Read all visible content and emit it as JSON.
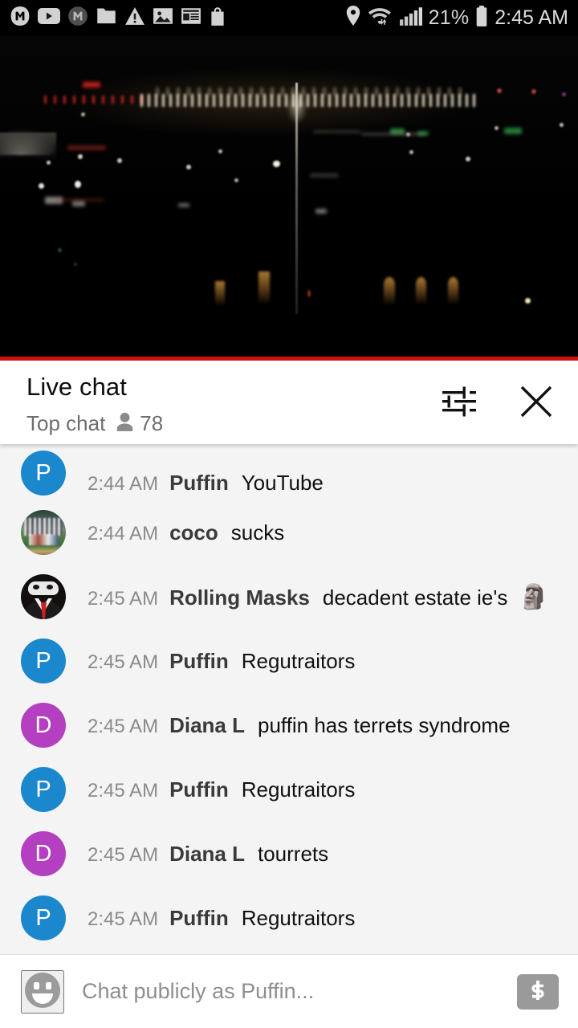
{
  "status_bar": {
    "left_icons": [
      "mail-m-icon",
      "youtube-icon",
      "m-badge-icon",
      "folder-icon",
      "warning-icon",
      "photo-icon",
      "news-icon",
      "shopping-bag-icon"
    ],
    "location_icon": "location-pin-icon",
    "wifi_icon": "wifi-icon",
    "signal_icon": "cellular-signal-icon",
    "battery_label": "21%",
    "battery_icon": "battery-icon",
    "time": "2:45 AM"
  },
  "video": {
    "name": "live-video-player",
    "description": "night cityscape with monument dome and flagpole",
    "progress_color": "#cf1312",
    "progress_percent": 100
  },
  "chat_header": {
    "title": "Live chat",
    "mode_label": "Top chat",
    "viewer_icon": "person-icon",
    "viewer_count": "78",
    "settings_icon": "tune-sliders-icon",
    "close_icon": "close-x-icon"
  },
  "messages": [
    {
      "avatar_type": "letter",
      "avatar_letter": "P",
      "avatar_color": "#1b87cc",
      "time": "2:44 AM",
      "author": "Puffin",
      "text": "YouTube",
      "emoji": ""
    },
    {
      "avatar_type": "photo",
      "avatar_letter": "",
      "avatar_color": "#4e7a47",
      "time": "2:44 AM",
      "author": "coco",
      "text": "sucks",
      "emoji": ""
    },
    {
      "avatar_type": "mask",
      "avatar_letter": "",
      "avatar_color": "#120f0e",
      "time": "2:45 AM",
      "author": "Rolling Masks",
      "text": "decadent estate ie's",
      "emoji": "🗿"
    },
    {
      "avatar_type": "letter",
      "avatar_letter": "P",
      "avatar_color": "#1b87cc",
      "time": "2:45 AM",
      "author": "Puffin",
      "text": "Regutraitors",
      "emoji": ""
    },
    {
      "avatar_type": "letter",
      "avatar_letter": "D",
      "avatar_color": "#b43fc1",
      "time": "2:45 AM",
      "author": "Diana L",
      "text": "puffin has terrets syndrome",
      "emoji": ""
    },
    {
      "avatar_type": "letter",
      "avatar_letter": "P",
      "avatar_color": "#1b87cc",
      "time": "2:45 AM",
      "author": "Puffin",
      "text": "Regutraitors",
      "emoji": ""
    },
    {
      "avatar_type": "letter",
      "avatar_letter": "D",
      "avatar_color": "#b43fc1",
      "time": "2:45 AM",
      "author": "Diana L",
      "text": "tourrets",
      "emoji": ""
    },
    {
      "avatar_type": "letter",
      "avatar_letter": "P",
      "avatar_color": "#1b87cc",
      "time": "2:45 AM",
      "author": "Puffin",
      "text": "Regutraitors",
      "emoji": ""
    }
  ],
  "input_bar": {
    "emoji_icon": "emoji-smiley-icon",
    "placeholder": "Chat publicly as Puffin...",
    "value": "",
    "superchat_icon": "dollar-superchat-icon"
  }
}
